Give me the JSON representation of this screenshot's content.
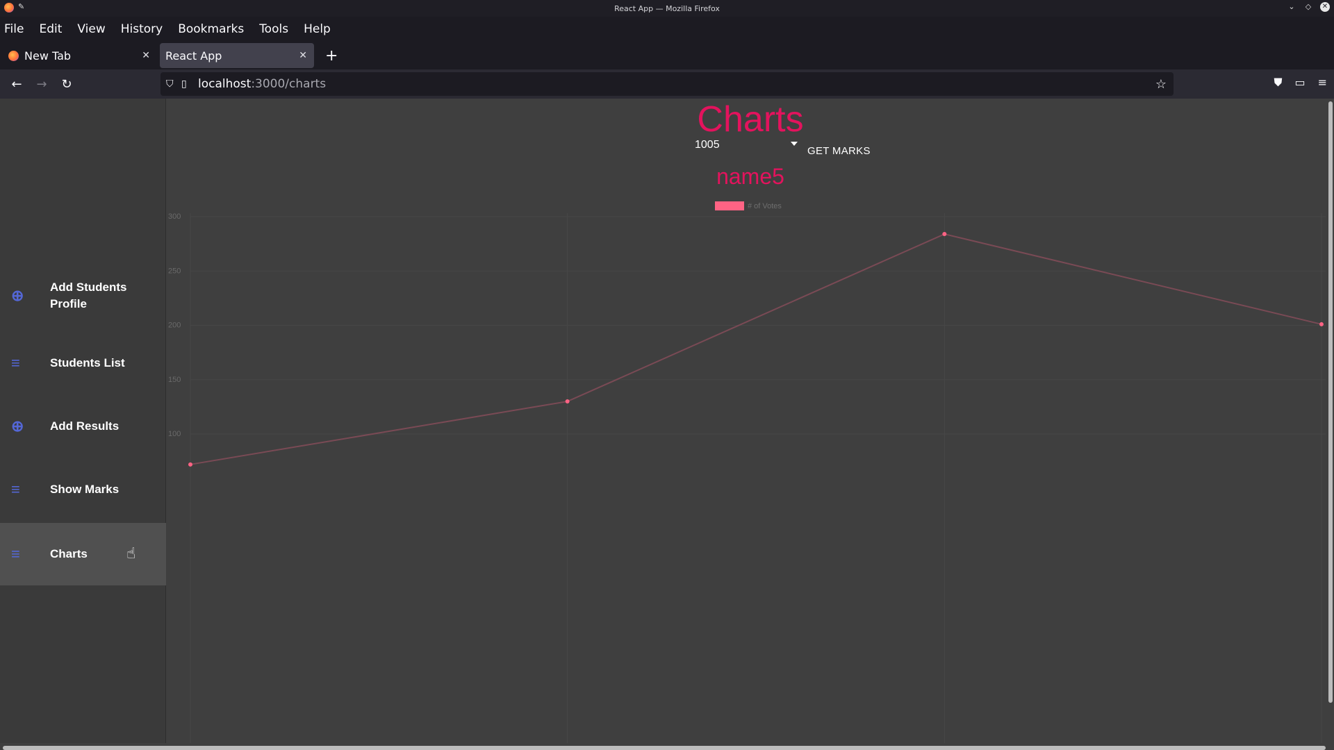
{
  "window": {
    "title": "React App — Mozilla Firefox"
  },
  "menu": [
    "File",
    "Edit",
    "View",
    "History",
    "Bookmarks",
    "Tools",
    "Help"
  ],
  "tabs": [
    {
      "label": "New Tab",
      "active": false
    },
    {
      "label": "React App",
      "active": true
    }
  ],
  "url": {
    "host": "localhost",
    "path": ":3000/charts"
  },
  "sidebar": {
    "items": [
      {
        "label": "Add Students Profile",
        "icon": "add-circle-icon"
      },
      {
        "label": "Students List",
        "icon": "list-icon"
      },
      {
        "label": "Add Results",
        "icon": "add-circle-icon"
      },
      {
        "label": "Show Marks",
        "icon": "list-icon"
      },
      {
        "label": "Charts",
        "icon": "list-icon",
        "active": true
      }
    ]
  },
  "main": {
    "title": "Charts",
    "select_value": "1005",
    "button_label": "GET MARKS"
  },
  "colors": {
    "accent": "#e3135d",
    "sidebar_icon": "#5467d6",
    "line": "#ff6384"
  },
  "chart_data": {
    "type": "line",
    "title": "name5",
    "legend": "top",
    "series": [
      {
        "name": "# of Votes",
        "values": [
          72,
          130,
          284,
          201
        ]
      }
    ],
    "ylim": [
      0,
      300
    ],
    "yticks": [
      300,
      250,
      200,
      150,
      100
    ],
    "grid": true
  }
}
